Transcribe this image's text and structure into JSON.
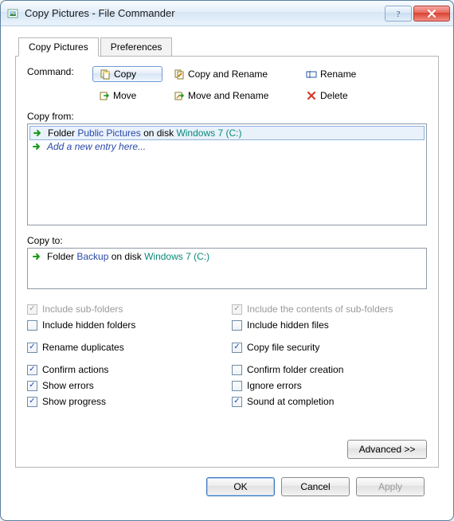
{
  "window": {
    "title": "Copy Pictures - File Commander"
  },
  "tabs": {
    "copy_pictures": "Copy Pictures",
    "preferences": "Preferences"
  },
  "labels": {
    "command": "Command:",
    "copy_from": "Copy from:",
    "copy_to": "Copy to:"
  },
  "commands": {
    "copy": "Copy",
    "copy_and_rename": "Copy and Rename",
    "rename": "Rename",
    "move": "Move",
    "move_and_rename": "Move and Rename",
    "delete": "Delete"
  },
  "copy_from_entry": {
    "prefix": "Folder ",
    "name": "Public Pictures",
    "mid": " on disk ",
    "disk": "Windows 7 (C:)"
  },
  "copy_from_add": "Add a new entry here...",
  "copy_to_entry": {
    "prefix": "Folder ",
    "name": "Backup",
    "mid": " on disk ",
    "disk": "Windows 7 (C:)"
  },
  "options": {
    "include_sub": "Include sub-folders",
    "include_contents": "Include the contents of sub-folders",
    "include_hidden_folders": "Include hidden folders",
    "include_hidden_files": "Include hidden files",
    "rename_dup": "Rename duplicates",
    "copy_security": "Copy file security",
    "confirm_actions": "Confirm actions",
    "confirm_folder": "Confirm folder creation",
    "show_errors": "Show errors",
    "ignore_errors": "Ignore errors",
    "show_progress": "Show progress",
    "sound": "Sound at completion"
  },
  "buttons": {
    "advanced": "Advanced >>",
    "ok": "OK",
    "cancel": "Cancel",
    "apply": "Apply"
  }
}
